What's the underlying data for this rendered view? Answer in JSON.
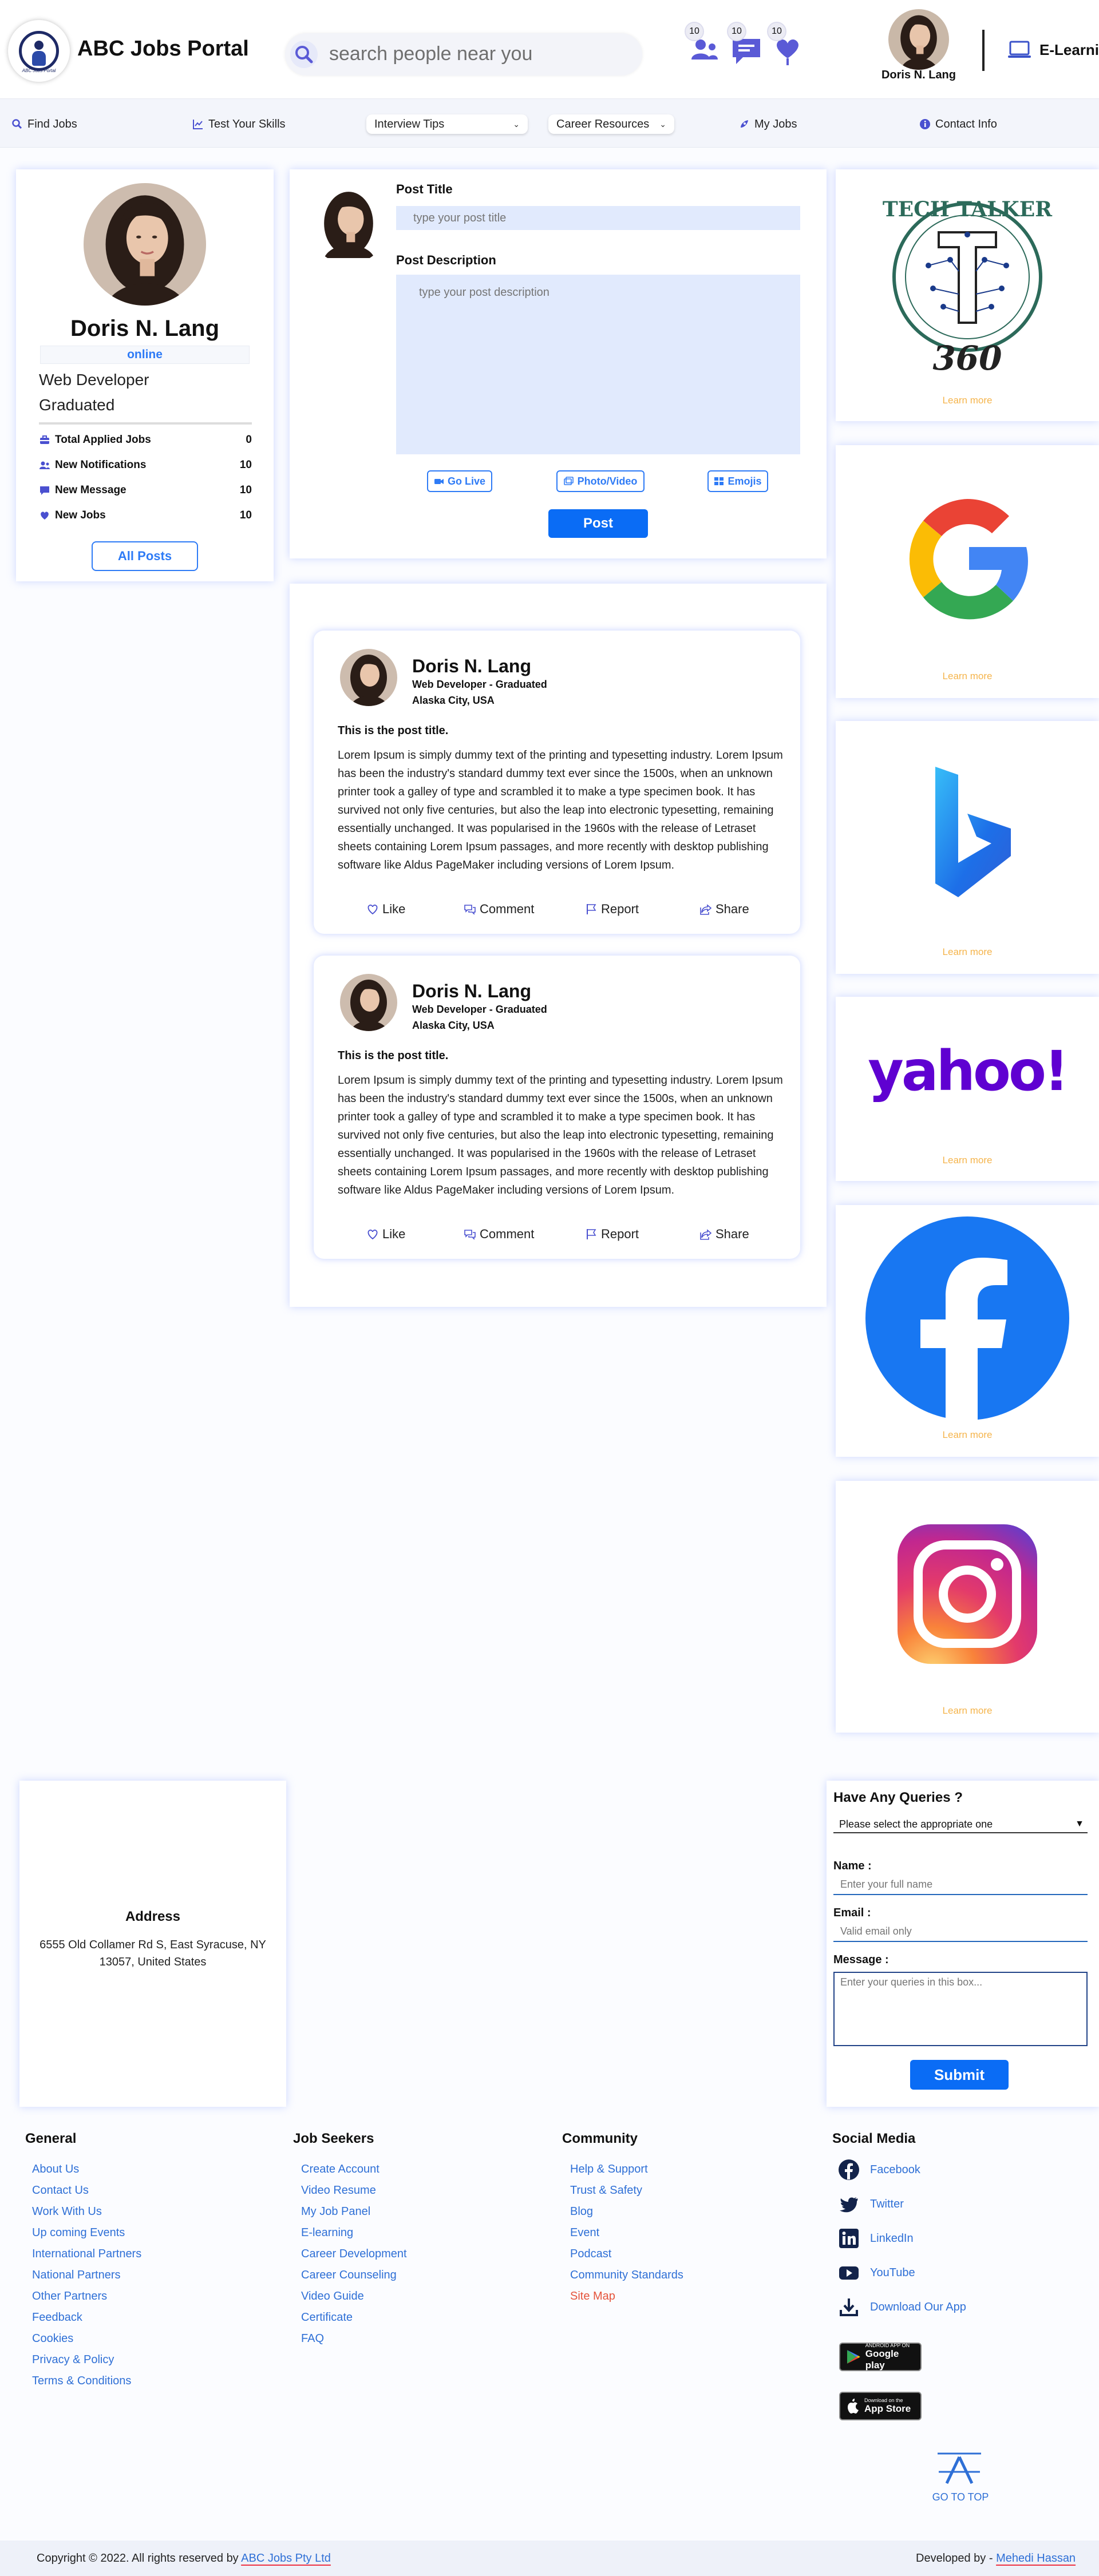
{
  "header": {
    "app_title": "ABC Jobs Portal",
    "logo_tagline": "ABC Jobs Portal",
    "search_placeholder": "search people near you",
    "notifications_count": "10",
    "messages_count": "10",
    "jobs_count": "10",
    "user_name": "Doris N. Lang",
    "elearning_label": "E-Learning"
  },
  "nav": {
    "items": [
      {
        "label": "Find Jobs",
        "icon": "search-icon"
      },
      {
        "label": "Test Your Skills",
        "icon": "chart-icon"
      },
      {
        "label": "Interview Tips",
        "icon": "chevron-down-icon"
      },
      {
        "label": "Career Resources",
        "icon": "chevron-down-icon"
      },
      {
        "label": "My Jobs",
        "icon": "rocket-icon"
      },
      {
        "label": "Contact Info",
        "icon": "info-icon"
      }
    ]
  },
  "profile": {
    "name": "Doris N. Lang",
    "status": "online",
    "title": "Web Developer",
    "education": "Graduated",
    "stats": [
      {
        "label": "Total Applied Jobs",
        "value": "0",
        "icon": "briefcase-icon"
      },
      {
        "label": "New Notifications",
        "value": "10",
        "icon": "users-icon"
      },
      {
        "label": "New Message",
        "value": "10",
        "icon": "message-icon"
      },
      {
        "label": "New Jobs",
        "value": "10",
        "icon": "heart-icon"
      }
    ],
    "all_posts_label": "All Posts"
  },
  "composer": {
    "title_label": "Post Title",
    "title_placeholder": "type your post title",
    "desc_label": "Post Description",
    "desc_placeholder": "type your post description",
    "go_live_label": "Go Live",
    "photo_video_label": "Photo/Video",
    "emojis_label": "Emojis",
    "post_button_label": "Post"
  },
  "feed": {
    "posts": [
      {
        "author": "Doris N. Lang",
        "role": "Web Developer - Graduated",
        "location": "Alaska City, USA",
        "title": "This is the post title.",
        "body": "Lorem Ipsum is simply dummy text of the printing and typesetting industry. Lorem Ipsum has been the industry's standard dummy text ever since the 1500s, when an unknown printer took a galley of type and scrambled it to make a type specimen book. It has survived not only five centuries, but also the leap into electronic typesetting, remaining essentially unchanged. It was popularised in the 1960s with the release of Letraset sheets containing Lorem Ipsum passages, and more recently with desktop publishing software like Aldus PageMaker including versions of Lorem Ipsum.",
        "actions": {
          "like": "Like",
          "comment": "Comment",
          "report": "Report",
          "share": "Share"
        }
      },
      {
        "author": "Doris N. Lang",
        "role": "Web Developer - Graduated",
        "location": "Alaska City, USA",
        "title": "This is the post title.",
        "body": "Lorem Ipsum is simply dummy text of the printing and typesetting industry. Lorem Ipsum has been the industry's standard dummy text ever since the 1500s, when an unknown printer took a galley of type and scrambled it to make a type specimen book. It has survived not only five centuries, but also the leap into electronic typesetting, remaining essentially unchanged. It was popularised in the 1960s with the release of Letraset sheets containing Lorem Ipsum passages, and more recently with desktop publishing software like Aldus PageMaker including versions of Lorem Ipsum.",
        "actions": {
          "like": "Like",
          "comment": "Comment",
          "report": "Report",
          "share": "Share"
        }
      }
    ]
  },
  "ads": {
    "learn_more_label": "Learn more",
    "items": [
      {
        "name": "Tech Talker 360",
        "logo_text": "TECH TALKER",
        "logo_number": "360"
      },
      {
        "name": "Google",
        "logo_letter": "G"
      },
      {
        "name": "Bing",
        "logo_letter": "b"
      },
      {
        "name": "Yahoo",
        "logo_text": "yahoo!"
      },
      {
        "name": "Facebook",
        "logo_letter": "f"
      },
      {
        "name": "Instagram"
      }
    ],
    "colors": {
      "learn_more": "#f5b44b",
      "google_red": "#ea4335",
      "google_yellow": "#fbbc05",
      "google_green": "#34a853",
      "google_blue": "#4285f4",
      "yahoo": "#5f01d1",
      "facebook": "#1877f2"
    }
  },
  "address": {
    "title": "Address",
    "text": "6555 Old Collamer Rd S, East Syracuse, NY 13057, United States"
  },
  "queries": {
    "title": "Have Any Queries ?",
    "select_value": "Please select the appropriate one",
    "name_label": "Name :",
    "name_placeholder": "Enter your full name",
    "email_label": "Email :",
    "email_placeholder": "Valid email only",
    "message_label": "Message :",
    "message_placeholder": "Enter your queries in this box...",
    "submit_label": "Submit"
  },
  "footer": {
    "general": {
      "heading": "General",
      "links": [
        "About Us",
        "Contact Us",
        "Work With Us",
        "Up coming Events",
        "International Partners",
        "National Partners",
        "Other Partners",
        "Feedback",
        "Cookies",
        "Privacy & Policy",
        "Terms & Conditions"
      ]
    },
    "job_seekers": {
      "heading": "Job Seekers",
      "links": [
        "Create Account",
        "Video Resume",
        "My Job Panel",
        "E-learning",
        "Career Development",
        "Career Counseling",
        "Video Guide",
        "Certificate",
        "FAQ"
      ]
    },
    "community": {
      "heading": "Community",
      "links": [
        "Help & Support",
        "Trust & Safety",
        "Blog",
        "Event",
        "Podcast",
        "Community Standards",
        "Site Map"
      ]
    },
    "social": {
      "heading": "Social Media",
      "links": [
        {
          "label": "Facebook",
          "icon": "facebook-icon"
        },
        {
          "label": "Twitter",
          "icon": "twitter-icon"
        },
        {
          "label": "LinkedIn",
          "icon": "linkedin-icon"
        },
        {
          "label": "YouTube",
          "icon": "youtube-icon"
        },
        {
          "label": "Download Our App",
          "icon": "download-icon"
        }
      ],
      "google_play": {
        "small": "ANDROID APP ON",
        "big": "Google play"
      },
      "app_store": {
        "small": "Download on the",
        "big": "App Store"
      }
    },
    "go_to_top": "GO TO TOP",
    "copyright_prefix": "Copyright © 2022. All rights reserved by",
    "copyright_link": "ABC Jobs Pty Ltd",
    "developer_prefix": "Developed by -",
    "developer_link": "Mehedi Hassan"
  }
}
